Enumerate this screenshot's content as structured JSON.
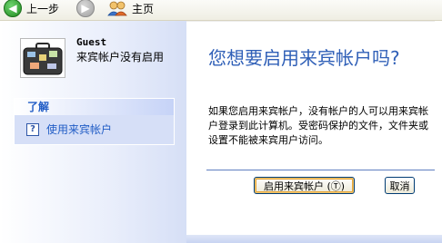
{
  "toolbar": {
    "back_label": "上一步",
    "home_label": "主页"
  },
  "account": {
    "name": "Guest",
    "status": "来宾帐户没有启用"
  },
  "learn": {
    "header": "了解",
    "link_label": "使用来宾帐户",
    "link_icon_glyph": "?"
  },
  "main": {
    "title": "您想要启用来宾帐户吗?",
    "description": "如果您启用来宾帐户，没有帐户的人可以用来宾帐户登录到此计算机。受密码保护的文件，文件夹或设置不能被来宾用户访问。",
    "enable_button": "启用来宾帐户 (Ⓣ)",
    "cancel_button": "取消"
  },
  "colors": {
    "accent": "#215dc6",
    "title": "#2f5fb7",
    "panel": "#d6dff7"
  }
}
